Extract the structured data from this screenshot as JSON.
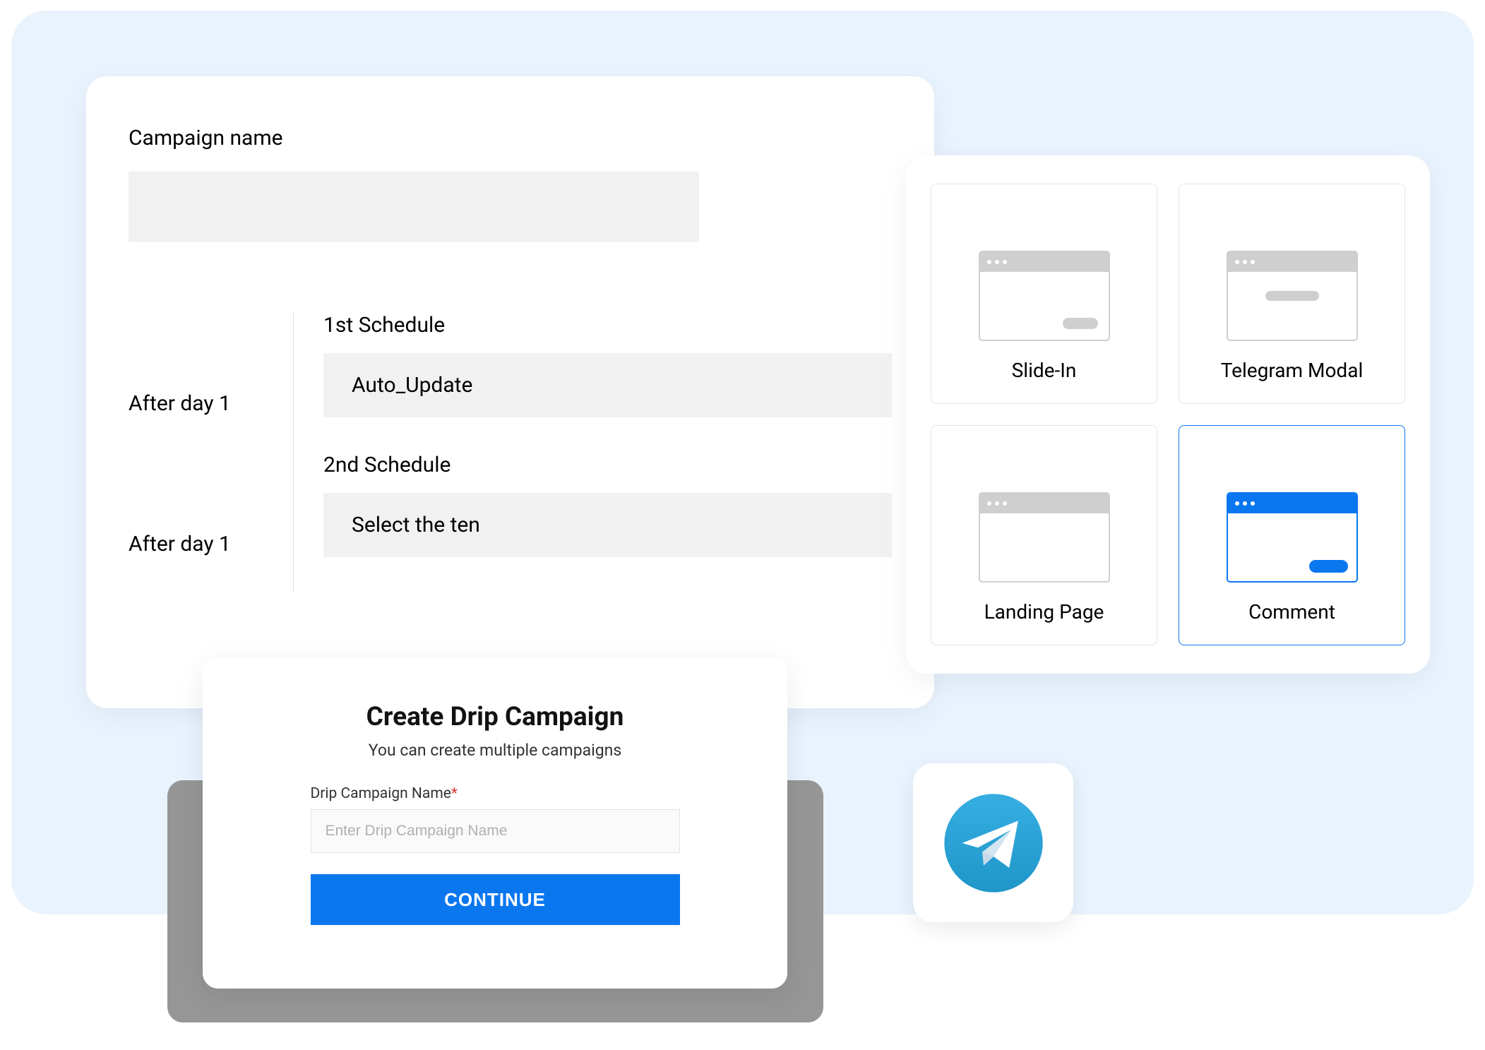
{
  "campaign": {
    "label": "Campaign name",
    "value": "",
    "schedules": [
      {
        "after": "After day 1",
        "title": "1st Schedule",
        "value": "Auto_Update"
      },
      {
        "after": "After day 1",
        "title": "2nd Schedule",
        "value": "Select the ten"
      }
    ]
  },
  "drip_modal": {
    "title": "Create Drip Campaign",
    "subtitle": "You can create multiple campaigns",
    "field_label": "Drip Campaign Name",
    "required_marker": "*",
    "placeholder": "Enter Drip Campaign Name",
    "value": "",
    "continue_label": "CONTINUE"
  },
  "templates": [
    {
      "label": "Slide-In",
      "active": false
    },
    {
      "label": "Telegram Modal",
      "active": false
    },
    {
      "label": "Landing Page",
      "active": false
    },
    {
      "label": "Comment",
      "active": true
    }
  ],
  "telegram": {
    "icon_name": "telegram-icon"
  }
}
